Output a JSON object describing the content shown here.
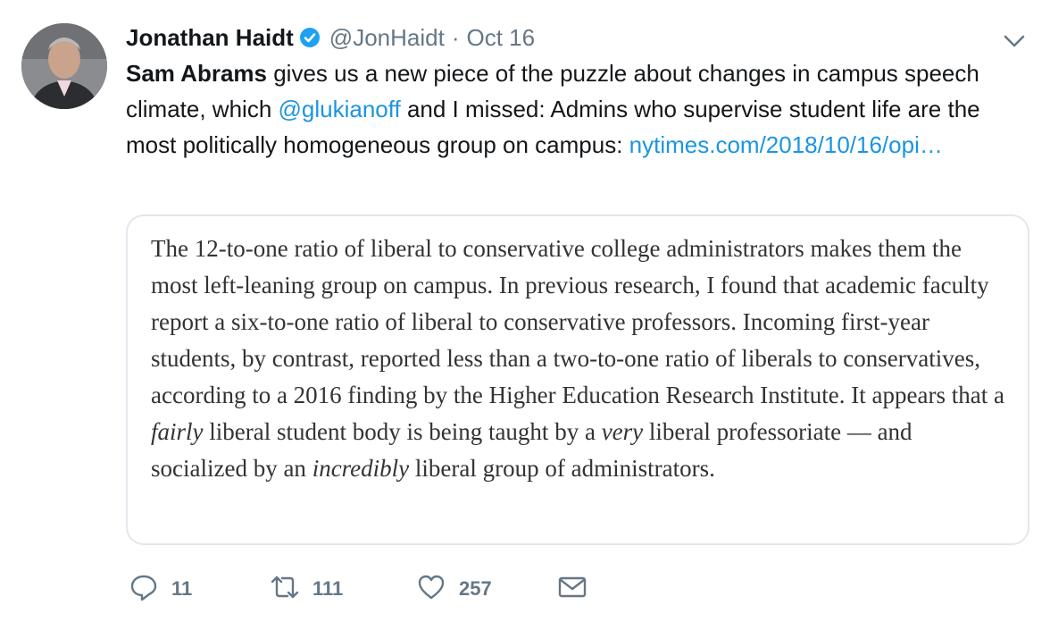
{
  "tweet": {
    "author_name": "Jonathan Haidt",
    "handle": "@JonHaidt",
    "separator": "·",
    "date": "Oct 16",
    "text": {
      "strong_mention": "Sam Abrams",
      "part1": " gives us a new piece of the puzzle about changes in campus speech climate, which ",
      "mention": "@glukianoff",
      "part2": " and I missed: Admins who supervise student life are the most politically homogeneous group on campus: ",
      "link": "nytimes.com/2018/10/16/opi…"
    },
    "quote": {
      "p1": "The 12-to-one ratio of liberal to conservative college administrators makes them the most left-leaning group on campus. In previous research, I found that academic faculty report a six-to-one ratio of liberal to conservative professors. Incoming first-year students, by contrast, reported less than a two-to-one ratio of liberals to conservatives, according to a 2016 finding by the Higher Education Research Institute. It appears that a ",
      "em1": "fairly",
      "p2": " liberal student body is being taught by a ",
      "em2": "very",
      "p3": " liberal professoriate — and socialized by an ",
      "em3": "incredibly",
      "p4": " liberal group of administrators."
    },
    "actions": {
      "replies": "11",
      "retweets": "111",
      "likes": "257"
    }
  },
  "icons": {
    "verified": "verified-badge-icon",
    "more": "chevron-down-icon",
    "reply": "reply-icon",
    "retweet": "retweet-icon",
    "like": "heart-icon",
    "message": "envelope-icon"
  },
  "colors": {
    "link": "#1b95e0",
    "muted": "#657786",
    "border": "#e1e8ed"
  }
}
